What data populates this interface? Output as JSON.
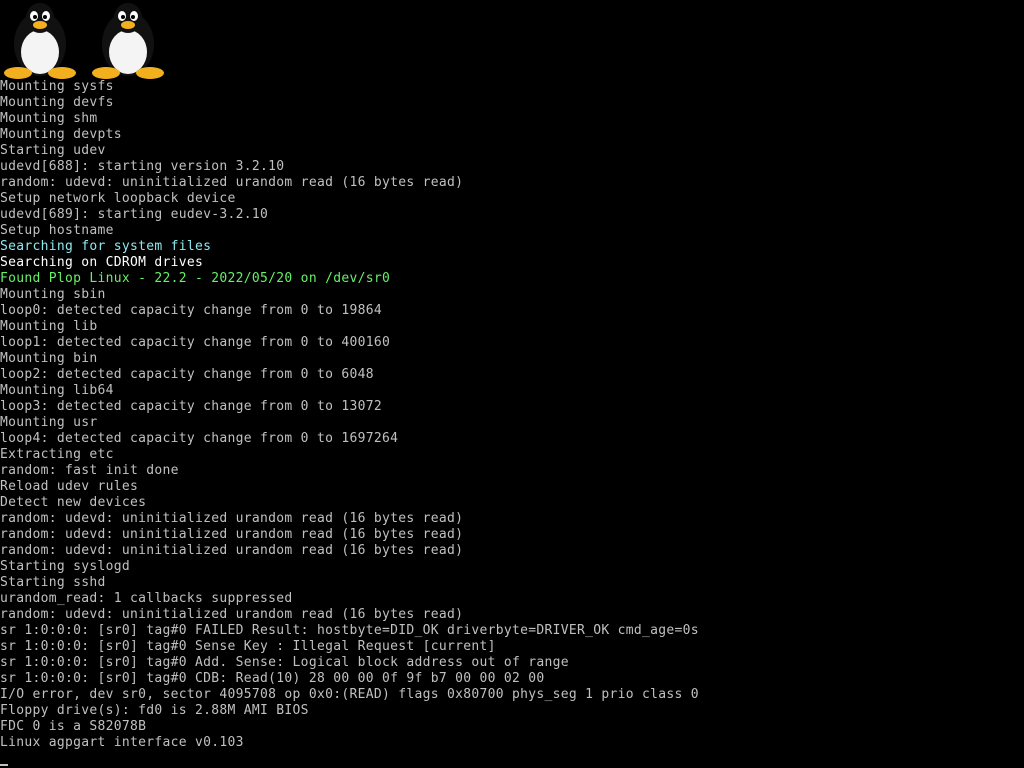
{
  "logo": {
    "icon": "tux-penguin-icon",
    "count": 2
  },
  "colors": {
    "background": "#000000",
    "default_text": "#c0c0c0",
    "bright_text": "#ffffff",
    "cyan_text": "#8ee8ee",
    "green_text": "#66f066"
  },
  "console": {
    "lines": [
      {
        "text": "Mounting sysfs",
        "style": "normal"
      },
      {
        "text": "Mounting devfs",
        "style": "normal"
      },
      {
        "text": "Mounting shm",
        "style": "normal"
      },
      {
        "text": "Mounting devpts",
        "style": "normal"
      },
      {
        "text": "Starting udev",
        "style": "normal"
      },
      {
        "text": "udevd[688]: starting version 3.2.10",
        "style": "normal"
      },
      {
        "text": "random: udevd: uninitialized urandom read (16 bytes read)",
        "style": "normal"
      },
      {
        "text": "Setup network loopback device",
        "style": "normal"
      },
      {
        "text": "udevd[689]: starting eudev-3.2.10",
        "style": "normal"
      },
      {
        "text": "Setup hostname",
        "style": "normal"
      },
      {
        "text": "Searching for system files",
        "style": "cyan"
      },
      {
        "text": "Searching on CDROM drives",
        "style": "bright"
      },
      {
        "text": "Found Plop Linux - 22.2 - 2022/05/20 on /dev/sr0",
        "style": "green"
      },
      {
        "text": "Mounting sbin",
        "style": "normal"
      },
      {
        "text": "loop0: detected capacity change from 0 to 19864",
        "style": "normal"
      },
      {
        "text": "Mounting lib",
        "style": "normal"
      },
      {
        "text": "loop1: detected capacity change from 0 to 400160",
        "style": "normal"
      },
      {
        "text": "Mounting bin",
        "style": "normal"
      },
      {
        "text": "loop2: detected capacity change from 0 to 6048",
        "style": "normal"
      },
      {
        "text": "Mounting lib64",
        "style": "normal"
      },
      {
        "text": "loop3: detected capacity change from 0 to 13072",
        "style": "normal"
      },
      {
        "text": "Mounting usr",
        "style": "normal"
      },
      {
        "text": "loop4: detected capacity change from 0 to 1697264",
        "style": "normal"
      },
      {
        "text": "Extracting etc",
        "style": "normal"
      },
      {
        "text": "random: fast init done",
        "style": "normal"
      },
      {
        "text": "Reload udev rules",
        "style": "normal"
      },
      {
        "text": "Detect new devices",
        "style": "normal"
      },
      {
        "text": "random: udevd: uninitialized urandom read (16 bytes read)",
        "style": "normal"
      },
      {
        "text": "random: udevd: uninitialized urandom read (16 bytes read)",
        "style": "normal"
      },
      {
        "text": "random: udevd: uninitialized urandom read (16 bytes read)",
        "style": "normal"
      },
      {
        "text": "Starting syslogd",
        "style": "normal"
      },
      {
        "text": "Starting sshd",
        "style": "normal"
      },
      {
        "text": "urandom_read: 1 callbacks suppressed",
        "style": "normal"
      },
      {
        "text": "random: udevd: uninitialized urandom read (16 bytes read)",
        "style": "normal"
      },
      {
        "text": "sr 1:0:0:0: [sr0] tag#0 FAILED Result: hostbyte=DID_OK driverbyte=DRIVER_OK cmd_age=0s",
        "style": "normal"
      },
      {
        "text": "sr 1:0:0:0: [sr0] tag#0 Sense Key : Illegal Request [current]",
        "style": "normal"
      },
      {
        "text": "sr 1:0:0:0: [sr0] tag#0 Add. Sense: Logical block address out of range",
        "style": "normal"
      },
      {
        "text": "sr 1:0:0:0: [sr0] tag#0 CDB: Read(10) 28 00 00 0f 9f b7 00 00 02 00",
        "style": "normal"
      },
      {
        "text": "I/O error, dev sr0, sector 4095708 op 0x0:(READ) flags 0x80700 phys_seg 1 prio class 0",
        "style": "normal"
      },
      {
        "text": "Floppy drive(s): fd0 is 2.88M AMI BIOS",
        "style": "normal"
      },
      {
        "text": "FDC 0 is a S82078B",
        "style": "normal"
      },
      {
        "text": "Linux agpgart interface v0.103",
        "style": "normal"
      }
    ]
  }
}
